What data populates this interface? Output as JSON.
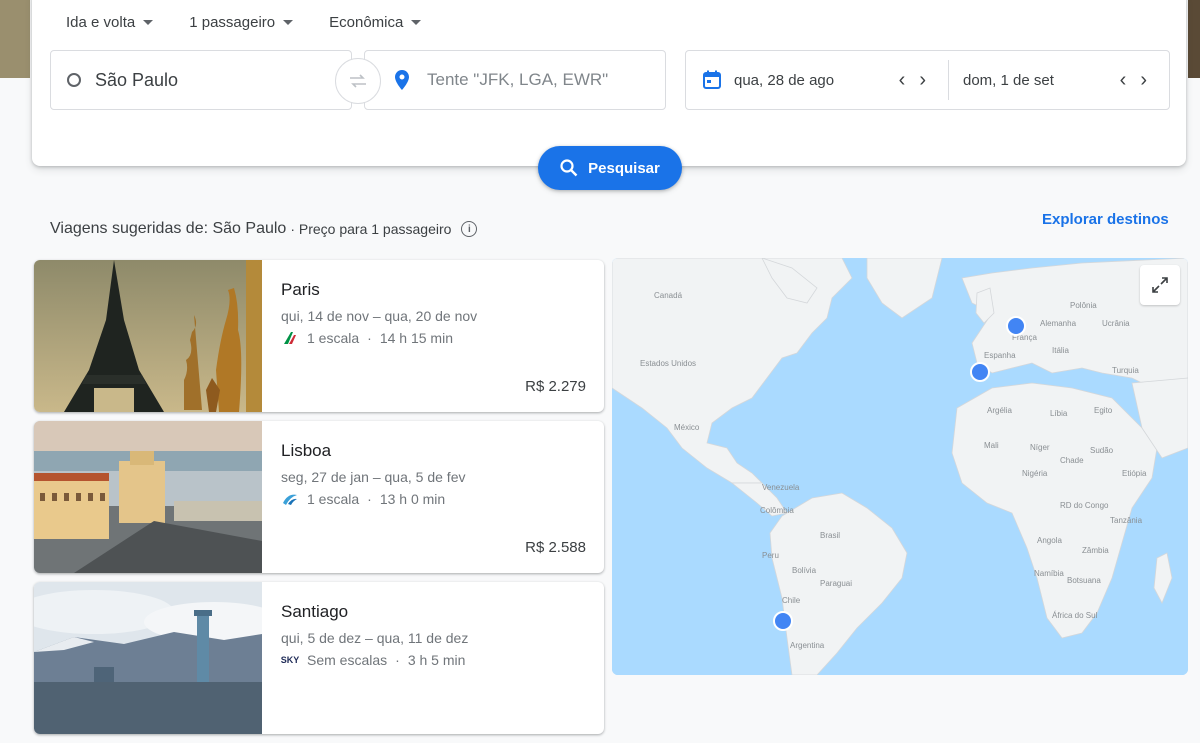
{
  "search": {
    "trip_type": "Ida e volta",
    "passengers": "1 passageiro",
    "cabin": "Econômica",
    "origin": "São Paulo",
    "destination_placeholder": "Tente \"JFK, LGA, EWR\"",
    "depart_date": "qua, 28 de ago",
    "return_date": "dom, 1 de set",
    "search_button": "Pesquisar"
  },
  "suggestions": {
    "title": "Viagens sugeridas de: São Paulo",
    "subtitle": "· Preço para 1 passageiro",
    "explore_link": "Explorar destinos",
    "trips": [
      {
        "city": "Paris",
        "dates": "qui, 14 de nov – qua, 20 de nov",
        "stops": "1 escala",
        "duration": "14 h 15 min",
        "price": "R$ 2.279",
        "airline_icon": "alitalia-logo-icon"
      },
      {
        "city": "Lisboa",
        "dates": "seg, 27 de jan – qua, 5 de fev",
        "stops": "1 escala",
        "duration": "13 h 0 min",
        "price": "R$ 2.588",
        "airline_icon": "airline-logo-icon"
      },
      {
        "city": "Santiago",
        "dates": "qui, 5 de dez – qua, 11 de dez",
        "stops": "Sem escalas",
        "duration": "3 h 5 min",
        "price": "",
        "airline_icon": "sky-airline-logo-icon"
      }
    ]
  },
  "map": {
    "labels": {
      "canada": "Canadá",
      "usa": "Estados Unidos",
      "mexico": "México",
      "venezuela": "Venezuela",
      "colombia": "Colômbia",
      "peru": "Peru",
      "brazil": "Brasil",
      "bolivia": "Bolívia",
      "argentina": "Argentina",
      "chile": "Chile",
      "paraguay": "Paraguai",
      "germany": "Alemanha",
      "france": "França",
      "spain": "Espanha",
      "poland": "Polônia",
      "ukraine": "Ucrânia",
      "italy": "Itália",
      "turkey": "Turquia",
      "algeria": "Argélia",
      "libya": "Líbia",
      "egypt": "Egito",
      "mali": "Mali",
      "niger": "Níger",
      "chad": "Chade",
      "sudan": "Sudão",
      "nigeria": "Nigéria",
      "ethiopia": "Etiópia",
      "drc": "RD do Congo",
      "tanzania": "Tanzânia",
      "angola": "Angola",
      "zambia": "Zâmbia",
      "namibia": "Namíbia",
      "botswana": "Botsuana",
      "south_africa": "África do Sul"
    },
    "colors": {
      "water": "#aadaff",
      "land": "#f1f3f4",
      "pin": "#4285f4"
    }
  }
}
